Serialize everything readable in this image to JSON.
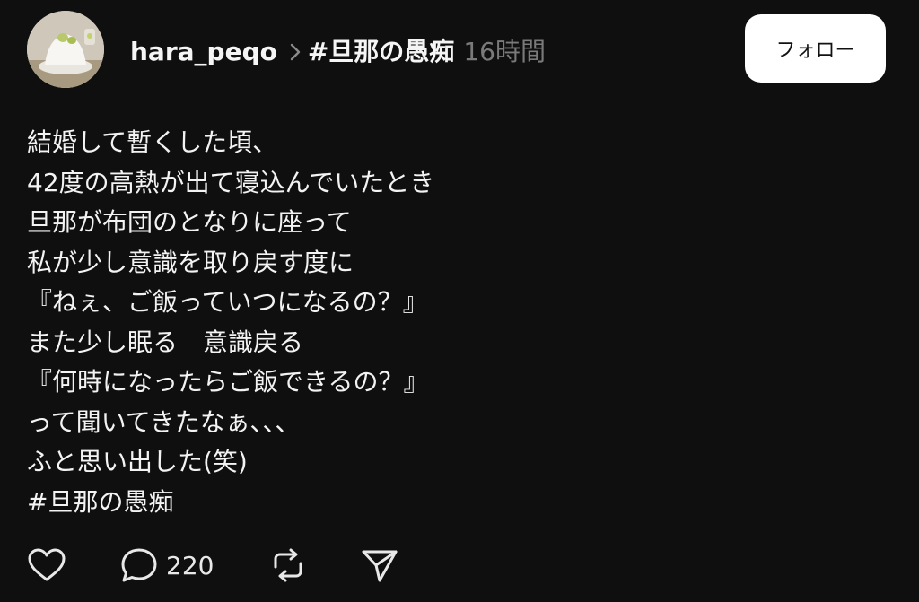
{
  "header": {
    "username": "hara_peqo",
    "hashtag": "#旦那の愚痴",
    "time": "16時間",
    "follow_label": "フォロー"
  },
  "post": {
    "lines": [
      "結婚して暫くした頃、",
      "42度の高熱が出て寝込んでいたとき",
      "旦那が布団のとなりに座って",
      "私が少し意識を取り戻す度に",
      "『ねぇ、ご飯っていつになるの？』",
      "また少し眠る　意識戻る",
      "『何時になったらご飯できるの？』",
      "って聞いてきたなぁ、、、",
      "ふと思い出した(笑)",
      "#旦那の愚痴"
    ]
  },
  "actions": {
    "like_icon": "heart-icon",
    "comment_icon": "comment-bubble-icon",
    "comment_count": "220",
    "repost_icon": "repost-icon",
    "share_icon": "send-icon"
  },
  "colors": {
    "background": "#0f0f0f",
    "text": "#f3f3f3",
    "muted": "#7a7a7a",
    "button_bg": "#ffffff",
    "button_text": "#111111"
  }
}
